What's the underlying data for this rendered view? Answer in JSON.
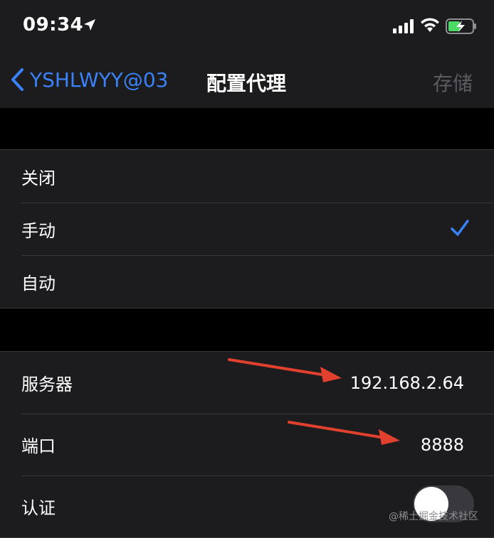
{
  "status_bar": {
    "time": "09:34",
    "icons": [
      "location-arrow-icon",
      "cellular-signal-icon",
      "wifi-icon",
      "battery-charging-icon"
    ],
    "battery_color": "#4cd964"
  },
  "nav": {
    "back_label": "YSHLWYY@03",
    "title": "配置代理",
    "save_label": "存储"
  },
  "proxy_modes": [
    {
      "label": "关闭",
      "selected": false
    },
    {
      "label": "手动",
      "selected": true
    },
    {
      "label": "自动",
      "selected": false
    }
  ],
  "manual_settings": {
    "server_label": "服务器",
    "server_value": "192.168.2.64",
    "port_label": "端口",
    "port_value": "8888",
    "auth_label": "认证",
    "auth_enabled": false
  },
  "annotations": {
    "arrow_color": "#e0402d"
  },
  "watermark": "@稀土掘金技术社区",
  "colors": {
    "accent": "#3a82f7",
    "cell_background": "#1c1c1e",
    "page_background": "#000000",
    "disabled_text": "#5b5b60"
  }
}
